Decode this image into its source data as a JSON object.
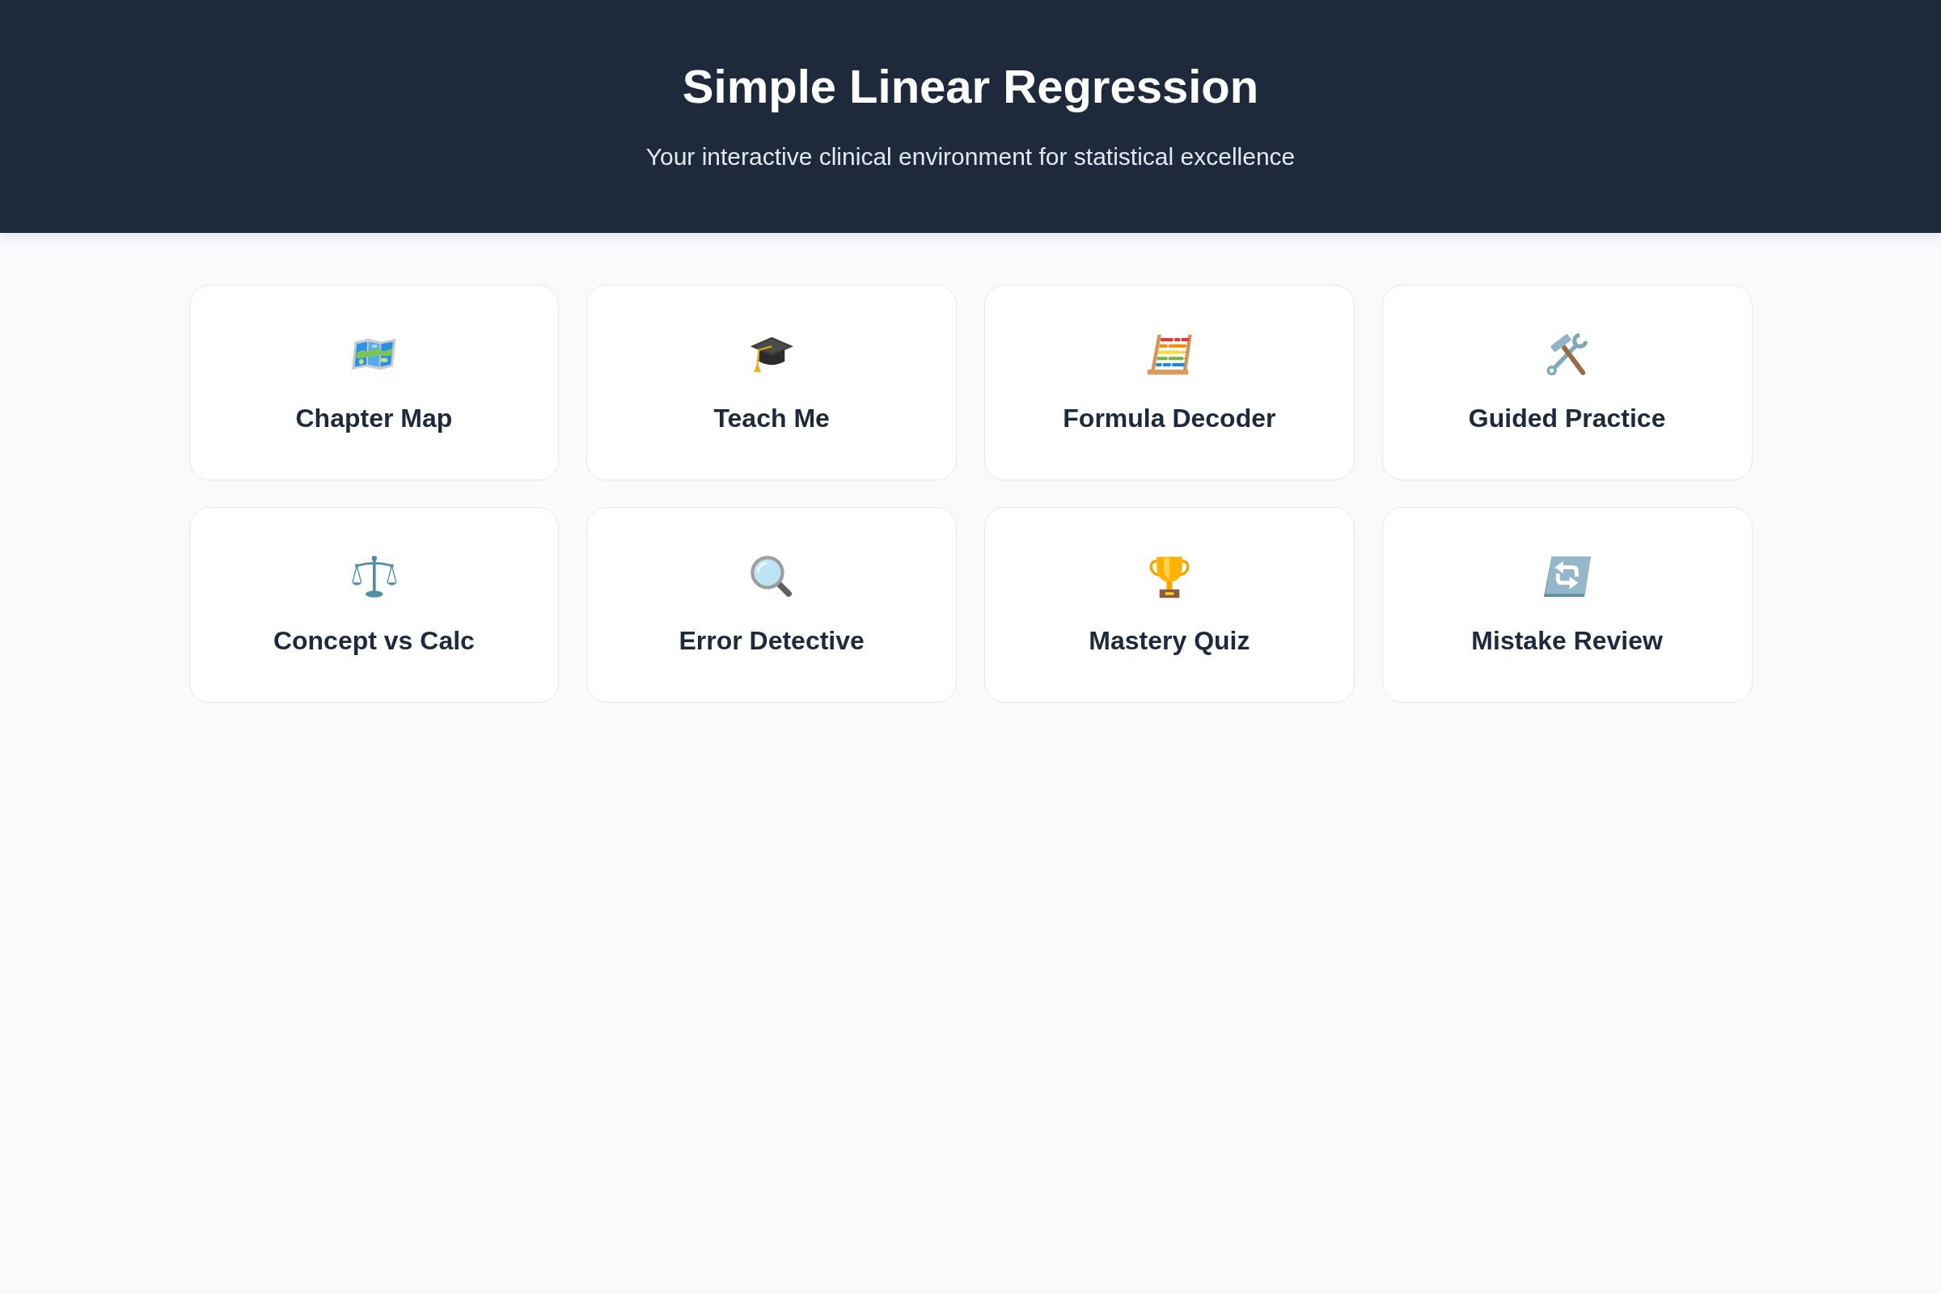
{
  "header": {
    "title": "Simple Linear Regression",
    "subtitle": "Your interactive clinical environment for statistical excellence"
  },
  "cards": [
    {
      "label": "Chapter Map"
    },
    {
      "label": "Teach Me"
    },
    {
      "label": "Formula Decoder"
    },
    {
      "label": "Guided Practice"
    },
    {
      "label": "Concept vs Calc"
    },
    {
      "label": "Error Detective"
    },
    {
      "label": "Mastery Quiz"
    },
    {
      "label": "Mistake Review"
    }
  ]
}
